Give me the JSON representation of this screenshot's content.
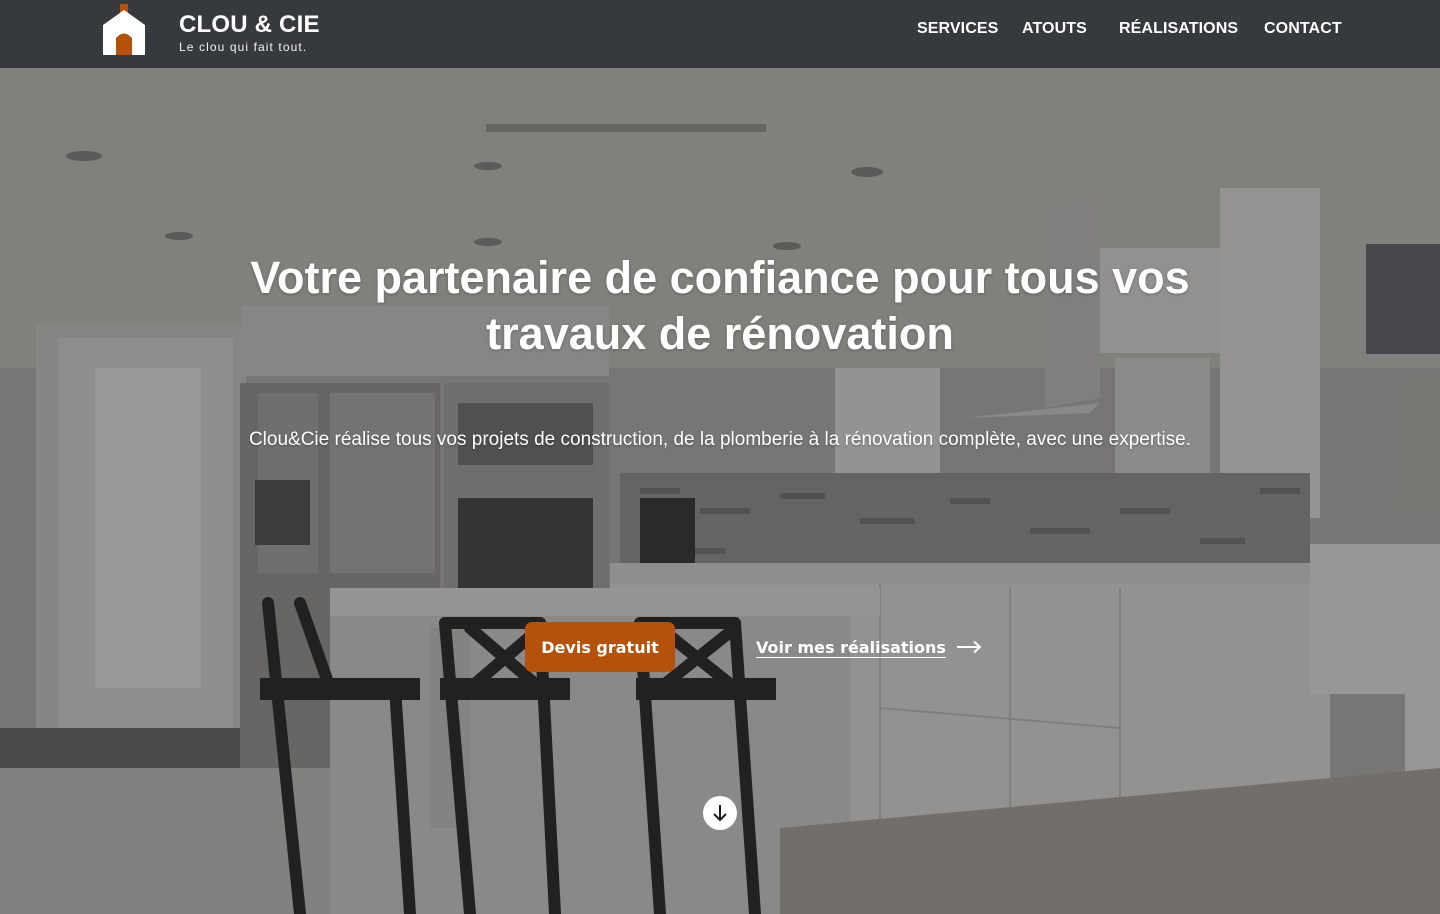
{
  "header": {
    "brand_name": "CLOU & CIE",
    "tagline": "Le clou qui fait tout.",
    "logo_icon": "house-icon",
    "nav": [
      {
        "label": "SERVICES"
      },
      {
        "label": "ATOUTS"
      },
      {
        "label": "RÉALISATIONS"
      },
      {
        "label": "CONTACT"
      }
    ]
  },
  "hero": {
    "background": "kitchen-photo",
    "title": "Votre partenaire de confiance pour tous vos travaux de rénovation",
    "subtitle": "Clou&Cie réalise tous vos projets de construction, de la plomberie à la rénovation complète, avec une expertise.",
    "primary_cta": "Devis gratuit",
    "secondary_cta": "Voir mes réalisations",
    "secondary_icon": "arrow-right-icon",
    "scroll_icon": "arrow-down-icon"
  },
  "colors": {
    "header_bg": "#36393d",
    "accent": "#b5520a",
    "text": "#ffffff"
  }
}
